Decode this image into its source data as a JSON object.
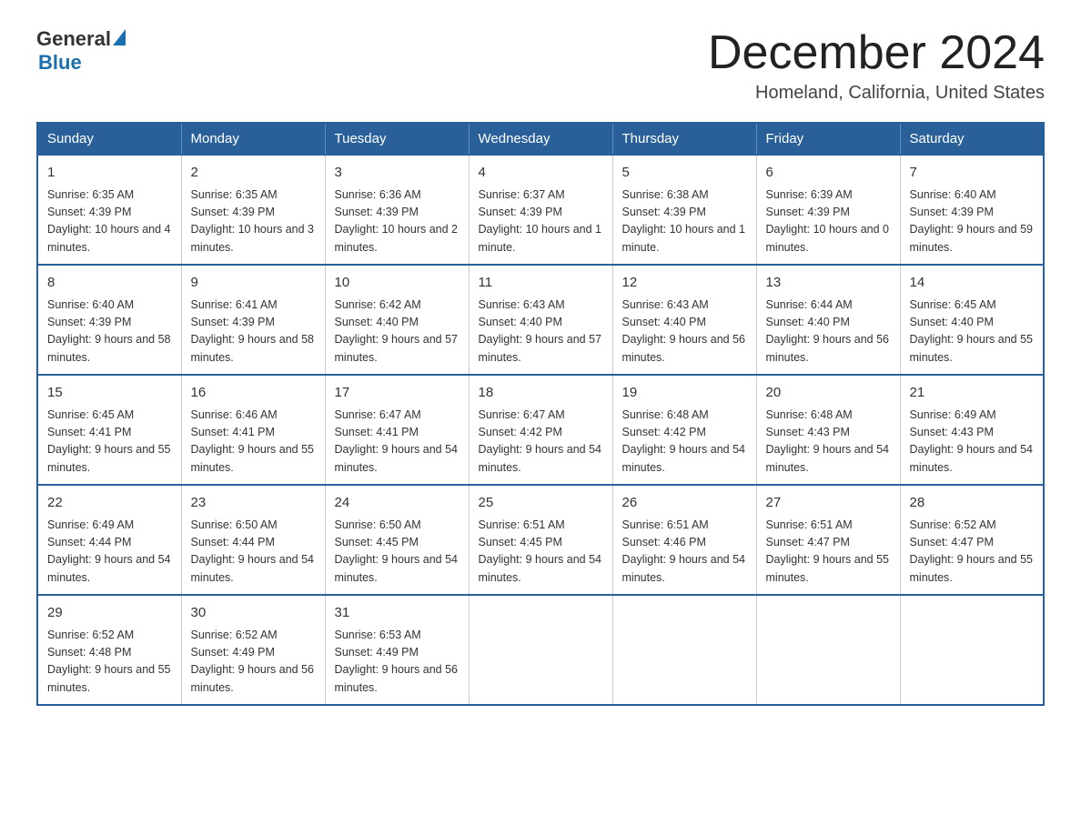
{
  "logo": {
    "text_general": "General",
    "triangle": "▲",
    "text_blue": "Blue"
  },
  "title": "December 2024",
  "location": "Homeland, California, United States",
  "days_of_week": [
    "Sunday",
    "Monday",
    "Tuesday",
    "Wednesday",
    "Thursday",
    "Friday",
    "Saturday"
  ],
  "weeks": [
    [
      {
        "day": "1",
        "sunrise": "6:35 AM",
        "sunset": "4:39 PM",
        "daylight": "10 hours and 4 minutes."
      },
      {
        "day": "2",
        "sunrise": "6:35 AM",
        "sunset": "4:39 PM",
        "daylight": "10 hours and 3 minutes."
      },
      {
        "day": "3",
        "sunrise": "6:36 AM",
        "sunset": "4:39 PM",
        "daylight": "10 hours and 2 minutes."
      },
      {
        "day": "4",
        "sunrise": "6:37 AM",
        "sunset": "4:39 PM",
        "daylight": "10 hours and 1 minute."
      },
      {
        "day": "5",
        "sunrise": "6:38 AM",
        "sunset": "4:39 PM",
        "daylight": "10 hours and 1 minute."
      },
      {
        "day": "6",
        "sunrise": "6:39 AM",
        "sunset": "4:39 PM",
        "daylight": "10 hours and 0 minutes."
      },
      {
        "day": "7",
        "sunrise": "6:40 AM",
        "sunset": "4:39 PM",
        "daylight": "9 hours and 59 minutes."
      }
    ],
    [
      {
        "day": "8",
        "sunrise": "6:40 AM",
        "sunset": "4:39 PM",
        "daylight": "9 hours and 58 minutes."
      },
      {
        "day": "9",
        "sunrise": "6:41 AM",
        "sunset": "4:39 PM",
        "daylight": "9 hours and 58 minutes."
      },
      {
        "day": "10",
        "sunrise": "6:42 AM",
        "sunset": "4:40 PM",
        "daylight": "9 hours and 57 minutes."
      },
      {
        "day": "11",
        "sunrise": "6:43 AM",
        "sunset": "4:40 PM",
        "daylight": "9 hours and 57 minutes."
      },
      {
        "day": "12",
        "sunrise": "6:43 AM",
        "sunset": "4:40 PM",
        "daylight": "9 hours and 56 minutes."
      },
      {
        "day": "13",
        "sunrise": "6:44 AM",
        "sunset": "4:40 PM",
        "daylight": "9 hours and 56 minutes."
      },
      {
        "day": "14",
        "sunrise": "6:45 AM",
        "sunset": "4:40 PM",
        "daylight": "9 hours and 55 minutes."
      }
    ],
    [
      {
        "day": "15",
        "sunrise": "6:45 AM",
        "sunset": "4:41 PM",
        "daylight": "9 hours and 55 minutes."
      },
      {
        "day": "16",
        "sunrise": "6:46 AM",
        "sunset": "4:41 PM",
        "daylight": "9 hours and 55 minutes."
      },
      {
        "day": "17",
        "sunrise": "6:47 AM",
        "sunset": "4:41 PM",
        "daylight": "9 hours and 54 minutes."
      },
      {
        "day": "18",
        "sunrise": "6:47 AM",
        "sunset": "4:42 PM",
        "daylight": "9 hours and 54 minutes."
      },
      {
        "day": "19",
        "sunrise": "6:48 AM",
        "sunset": "4:42 PM",
        "daylight": "9 hours and 54 minutes."
      },
      {
        "day": "20",
        "sunrise": "6:48 AM",
        "sunset": "4:43 PM",
        "daylight": "9 hours and 54 minutes."
      },
      {
        "day": "21",
        "sunrise": "6:49 AM",
        "sunset": "4:43 PM",
        "daylight": "9 hours and 54 minutes."
      }
    ],
    [
      {
        "day": "22",
        "sunrise": "6:49 AM",
        "sunset": "4:44 PM",
        "daylight": "9 hours and 54 minutes."
      },
      {
        "day": "23",
        "sunrise": "6:50 AM",
        "sunset": "4:44 PM",
        "daylight": "9 hours and 54 minutes."
      },
      {
        "day": "24",
        "sunrise": "6:50 AM",
        "sunset": "4:45 PM",
        "daylight": "9 hours and 54 minutes."
      },
      {
        "day": "25",
        "sunrise": "6:51 AM",
        "sunset": "4:45 PM",
        "daylight": "9 hours and 54 minutes."
      },
      {
        "day": "26",
        "sunrise": "6:51 AM",
        "sunset": "4:46 PM",
        "daylight": "9 hours and 54 minutes."
      },
      {
        "day": "27",
        "sunrise": "6:51 AM",
        "sunset": "4:47 PM",
        "daylight": "9 hours and 55 minutes."
      },
      {
        "day": "28",
        "sunrise": "6:52 AM",
        "sunset": "4:47 PM",
        "daylight": "9 hours and 55 minutes."
      }
    ],
    [
      {
        "day": "29",
        "sunrise": "6:52 AM",
        "sunset": "4:48 PM",
        "daylight": "9 hours and 55 minutes."
      },
      {
        "day": "30",
        "sunrise": "6:52 AM",
        "sunset": "4:49 PM",
        "daylight": "9 hours and 56 minutes."
      },
      {
        "day": "31",
        "sunrise": "6:53 AM",
        "sunset": "4:49 PM",
        "daylight": "9 hours and 56 minutes."
      },
      {
        "day": "",
        "sunrise": "",
        "sunset": "",
        "daylight": ""
      },
      {
        "day": "",
        "sunrise": "",
        "sunset": "",
        "daylight": ""
      },
      {
        "day": "",
        "sunrise": "",
        "sunset": "",
        "daylight": ""
      },
      {
        "day": "",
        "sunrise": "",
        "sunset": "",
        "daylight": ""
      }
    ]
  ]
}
